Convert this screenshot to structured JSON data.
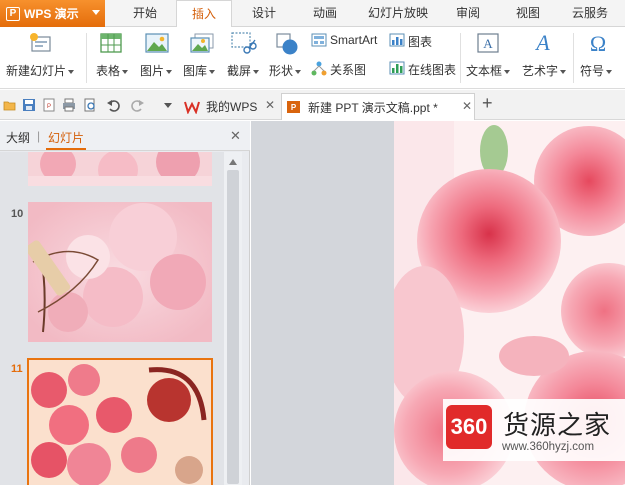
{
  "app": {
    "name": "WPS 演示",
    "logo_glyph": "P",
    "accent": "#e9740f"
  },
  "menu_tabs": [
    "开始",
    "插入",
    "设计",
    "动画",
    "幻灯片放映",
    "审阅",
    "视图",
    "云服务"
  ],
  "active_menu_tab": "插入",
  "ribbon": {
    "new_slide": "新建幻灯片",
    "table": "表格",
    "picture": "图片",
    "gallery": "图库",
    "screenshot": "截屏",
    "shape": "形状",
    "smartart": "SmartArt",
    "relation": "关系图",
    "chart": "图表",
    "online_chart": "在线图表",
    "textbox": "文本框",
    "wordart": "艺术字",
    "symbol": "符号"
  },
  "doc_tabs": [
    {
      "label": "我的WPS",
      "icon": "wps-icon"
    },
    {
      "label": "新建 PPT 演示文稿.ppt *",
      "icon": "ppt-file-icon"
    }
  ],
  "add_tab_glyph": "+",
  "close_glyph": "✕",
  "panel": {
    "tab_outline": "大纲",
    "tab_slides": "幻灯片",
    "divider": "|"
  },
  "slides": [
    {
      "number": "10"
    },
    {
      "number": "11"
    }
  ],
  "watermark": {
    "badge": "360",
    "title": "货源之家",
    "url": "www.360hyzj.com"
  }
}
